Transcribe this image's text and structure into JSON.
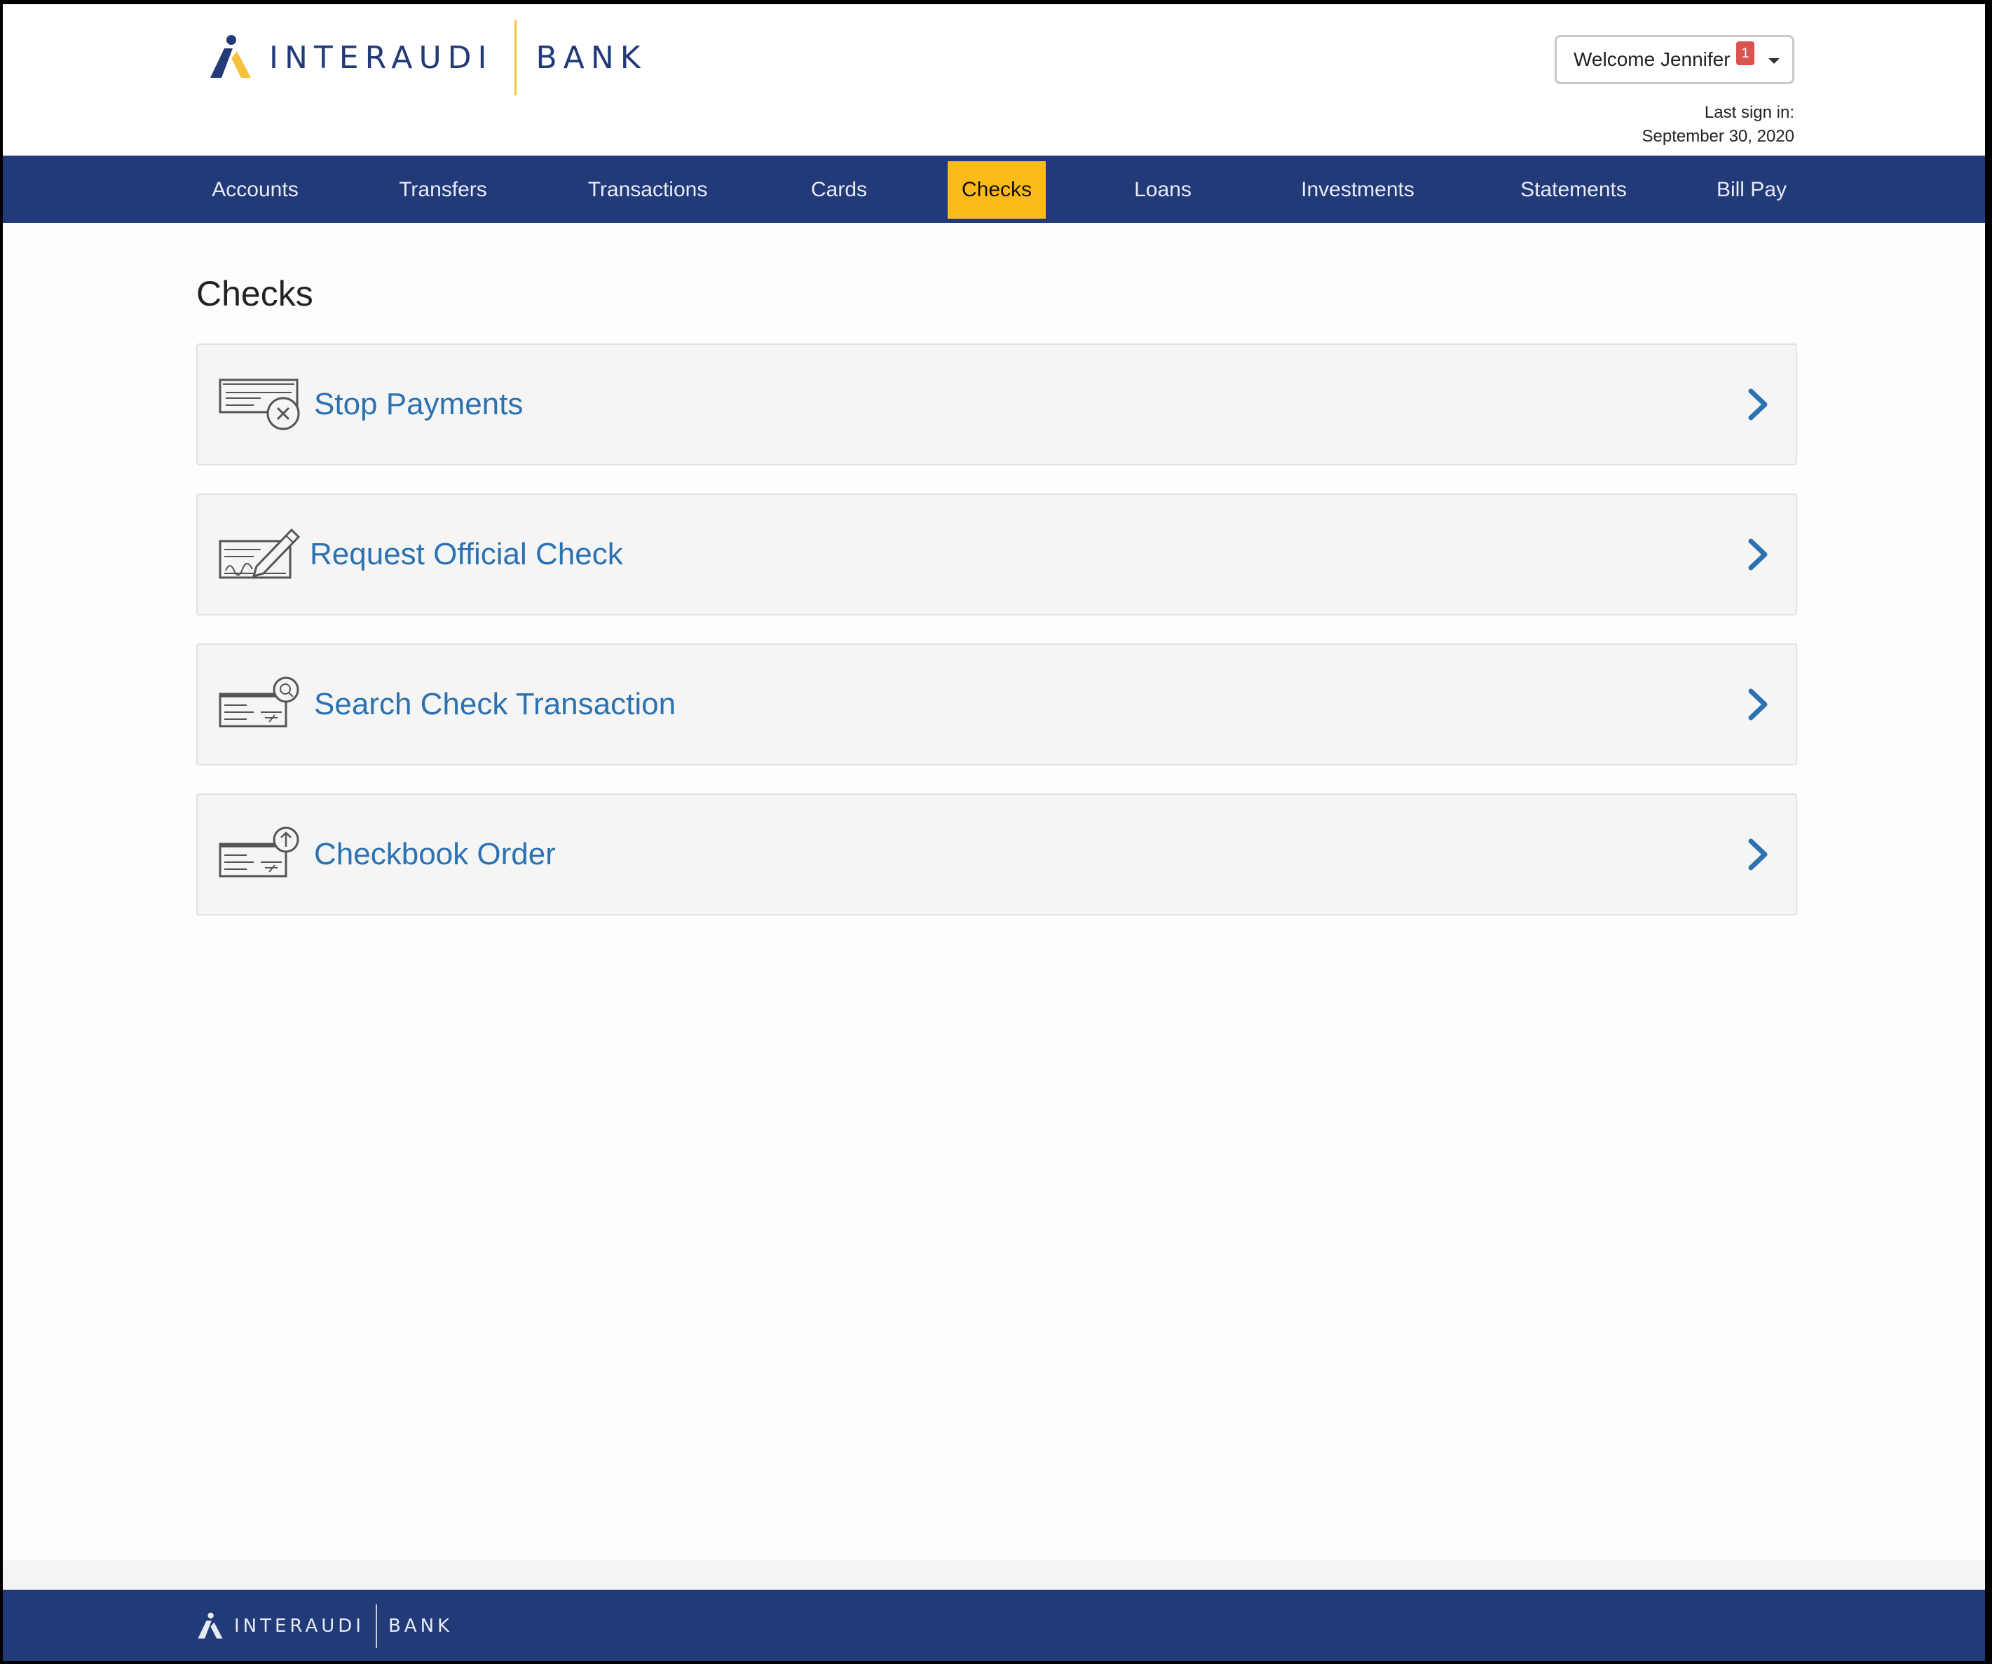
{
  "brand": {
    "name": "INTERAUDI",
    "suffix": "BANK",
    "primary_color": "#223a78",
    "accent_color": "#fbbb1b",
    "logo_icon": "interaudi-logo-mark"
  },
  "header": {
    "welcome_label": "Welcome Jennifer",
    "notification_count": "1",
    "last_sign_label": "Last sign in:",
    "last_sign_date": "September 30, 2020"
  },
  "nav": {
    "items": [
      {
        "label": "Accounts",
        "active": false
      },
      {
        "label": "Transfers",
        "active": false
      },
      {
        "label": "Transactions",
        "active": false
      },
      {
        "label": "Cards",
        "active": false
      },
      {
        "label": "Checks",
        "active": true
      },
      {
        "label": "Loans",
        "active": false
      },
      {
        "label": "Investments",
        "active": false
      },
      {
        "label": "Statements",
        "active": false
      },
      {
        "label": "Bill Pay",
        "active": false
      }
    ]
  },
  "main": {
    "title": "Checks",
    "options": [
      {
        "label": "Stop Payments",
        "icon": "stop-payment-check-icon"
      },
      {
        "label": "Request Official Check",
        "icon": "official-check-pen-icon"
      },
      {
        "label": "Search Check Transaction",
        "icon": "search-check-icon"
      },
      {
        "label": "Checkbook Order",
        "icon": "checkbook-order-icon"
      }
    ],
    "link_color": "#2c72b0"
  },
  "footer": {
    "brand_name": "INTERAUDI",
    "brand_suffix": "BANK"
  }
}
